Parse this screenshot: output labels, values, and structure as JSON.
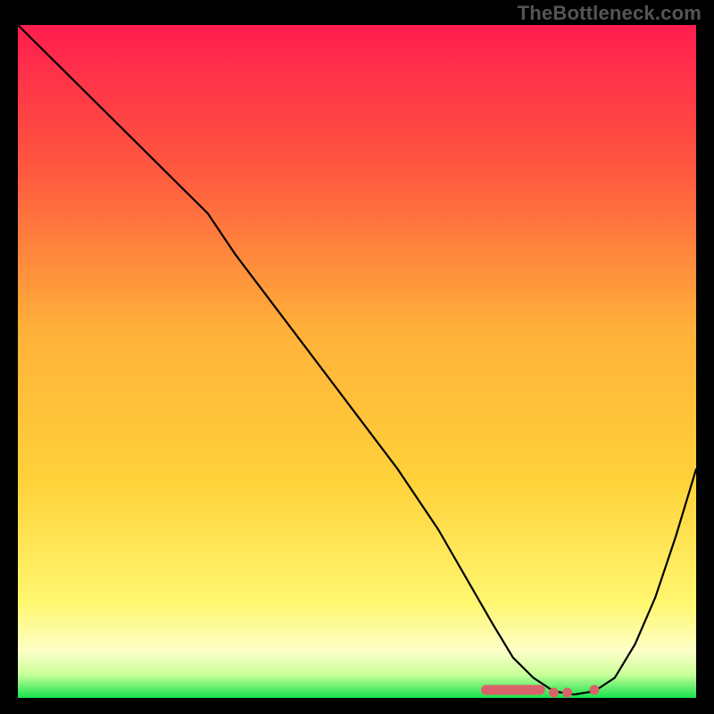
{
  "watermark": "TheBottleneck.com",
  "colors": {
    "bg": "#000000",
    "gradient_top": "#ff1d4e",
    "gradient_mid_upper": "#ff873b",
    "gradient_mid": "#ffd23a",
    "gradient_mid_lower": "#fff770",
    "gradient_band": "#fdffc8",
    "gradient_green": "#17e24c",
    "curve": "#000000",
    "marker_fill": "#d9626a",
    "marker_stroke": "#d9626a"
  },
  "chart_data": {
    "type": "line",
    "title": "",
    "xlabel": "",
    "ylabel": "",
    "xlim": [
      0,
      100
    ],
    "ylim": [
      0,
      100
    ],
    "series": [
      {
        "name": "bottleneck-curve",
        "x": [
          0,
          6,
          12,
          18,
          24,
          28,
          32,
          38,
          44,
          50,
          56,
          62,
          66,
          70,
          73,
          76,
          79,
          82,
          85,
          88,
          91,
          94,
          97,
          100
        ],
        "y": [
          100,
          94,
          88,
          82,
          76,
          72,
          66,
          58,
          50,
          42,
          34,
          25,
          18,
          11,
          6,
          3,
          1,
          0.5,
          1,
          3,
          8,
          15,
          24,
          34
        ]
      }
    ],
    "markers": [
      {
        "name": "highlight-segment",
        "type": "thick-run",
        "x_start": 69,
        "x_end": 77,
        "y": 1.2
      },
      {
        "name": "highlight-dot-1",
        "type": "dot",
        "x": 79,
        "y": 0.8
      },
      {
        "name": "highlight-dot-2",
        "type": "dot",
        "x": 81,
        "y": 0.8
      },
      {
        "name": "highlight-dot-3",
        "type": "dot",
        "x": 85,
        "y": 1.2
      }
    ],
    "note": "Values are read off the plot in percent of axis span; no axis ticks or labels are rendered in the image."
  }
}
